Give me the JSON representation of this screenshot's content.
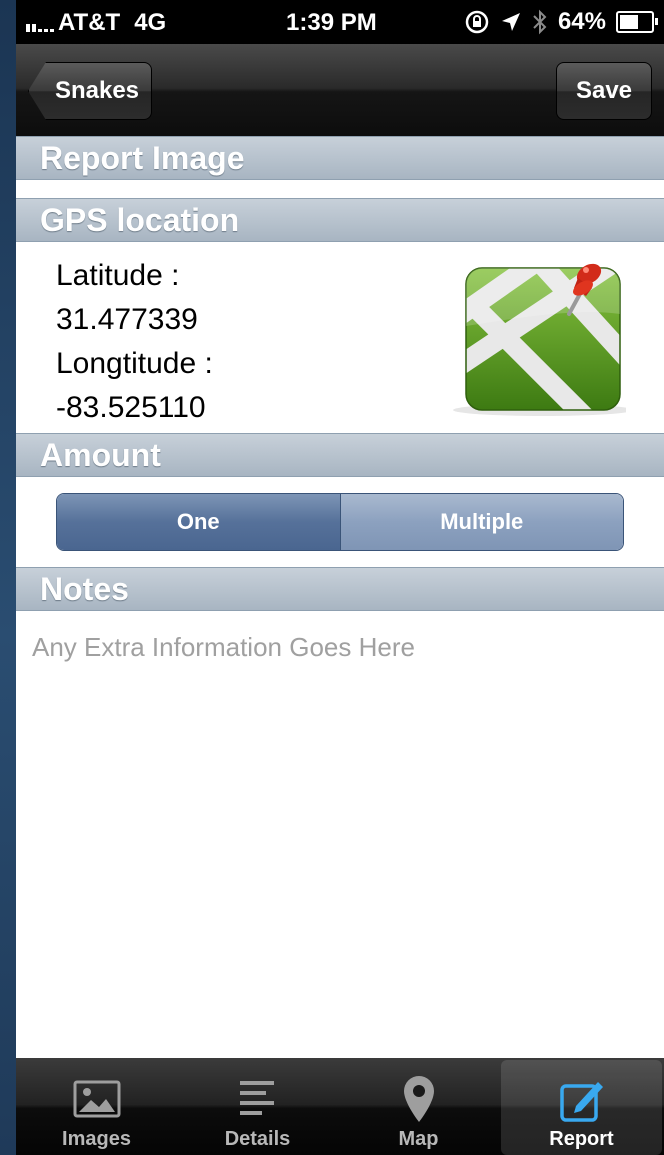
{
  "status_bar": {
    "carrier": "AT&T",
    "network": "4G",
    "time": "1:39 PM",
    "battery": "64%",
    "battery_level": 0.64
  },
  "nav": {
    "back_label": "Snakes",
    "save_label": "Save"
  },
  "sections": {
    "report_image": "Report Image",
    "gps": "GPS location",
    "amount": "Amount",
    "notes": "Notes"
  },
  "gps": {
    "latitude_label": "Latitude :",
    "latitude": "31.477339",
    "longitude_label": "Longtitude :",
    "longitude": "-83.525110"
  },
  "amount": {
    "options": [
      "One",
      "Multiple"
    ],
    "selected": "One"
  },
  "notes": {
    "placeholder": "Any Extra Information Goes Here"
  },
  "tabs": [
    {
      "label": "Images",
      "icon": "image-icon"
    },
    {
      "label": "Details",
      "icon": "list-icon"
    },
    {
      "label": "Map",
      "icon": "map-pin-icon"
    },
    {
      "label": "Report",
      "icon": "edit-icon",
      "active": true
    }
  ]
}
